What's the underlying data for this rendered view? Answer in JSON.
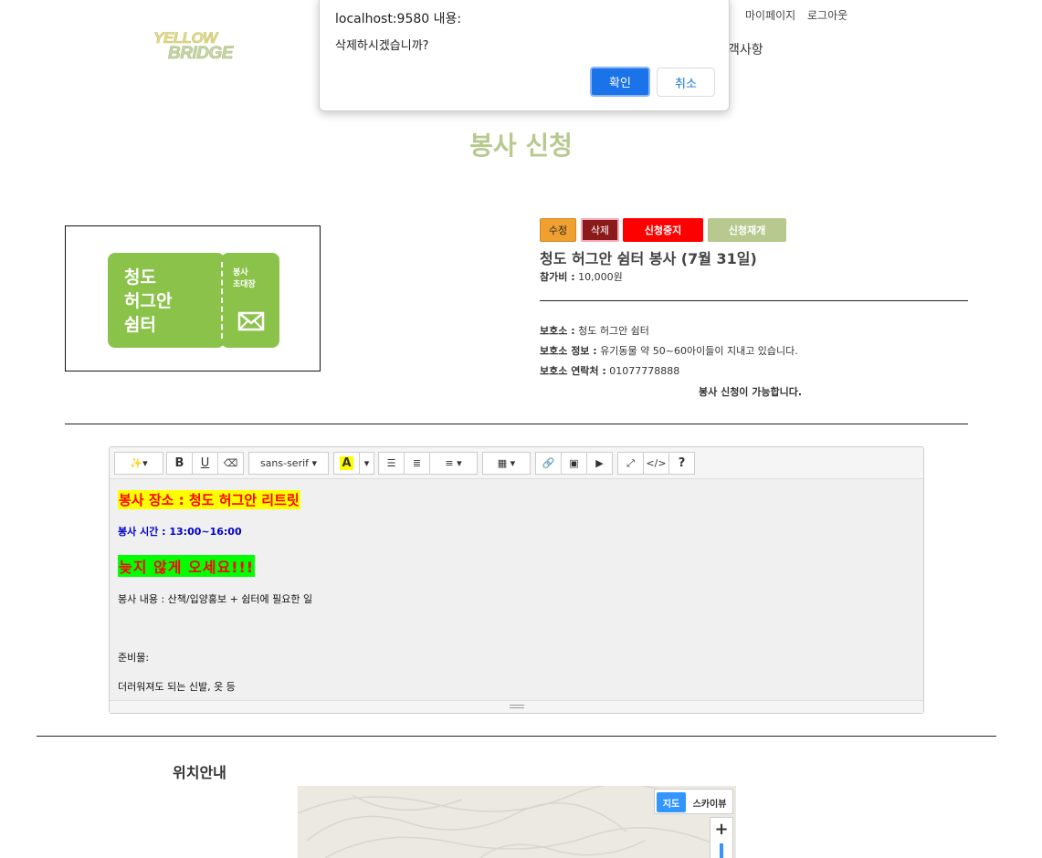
{
  "header": {
    "logo_line1": "YELLOW",
    "logo_line2": "BRIDGE",
    "mypage": "마이페이지",
    "logout": "로그아웃",
    "nav_partial": "객사항"
  },
  "dialog": {
    "title": "localhost:9580 내용:",
    "message": "삭제하시겠습니까?",
    "ok": "확인",
    "cancel": "취소"
  },
  "page_title": "봉사 신청",
  "thumbnail": {
    "main_text_1": "청도",
    "main_text_2": "허그안",
    "main_text_3": "쉼터",
    "sub_text_1": "봉사",
    "sub_text_2": "초대장"
  },
  "actions": {
    "edit": "수정",
    "delete": "삭제",
    "stop": "신청중지",
    "resume": "신청재개"
  },
  "event": {
    "title": "청도 허그안 쉼터 봉사 (7월 31일)",
    "fee_label": "참가비 :",
    "fee_value": "10,000원",
    "shelter_label": "보호소 :",
    "shelter_value": "청도 허그안 쉼터",
    "shelter_info_label": "보호소 정보 :",
    "shelter_info_value": "유기동물 약 50~60아이들이 지내고 있습니다.",
    "contact_label": "보호소 연락처 :",
    "contact_value": "01077778888",
    "availability": "봉사 신청이 가능합니다."
  },
  "editor": {
    "font_name": "sans-serif",
    "help": "?",
    "content": {
      "place": "봉사 장소 : 청도 허그안 리트릿",
      "time": "봉사 시간 : 13:00~16:00",
      "warning": "늦지 않게 오세요!!!",
      "description": "봉사 내용 : 산책/입양홍보 + 쉼터에 필요한 일",
      "prep_label": "준비물:",
      "prep_items": "더러워져도 되는 신발, 옷 등"
    }
  },
  "location": {
    "title": "위치안내",
    "map_button": "지도",
    "skyview_button": "스카이뷰",
    "zoom_in": "+"
  }
}
